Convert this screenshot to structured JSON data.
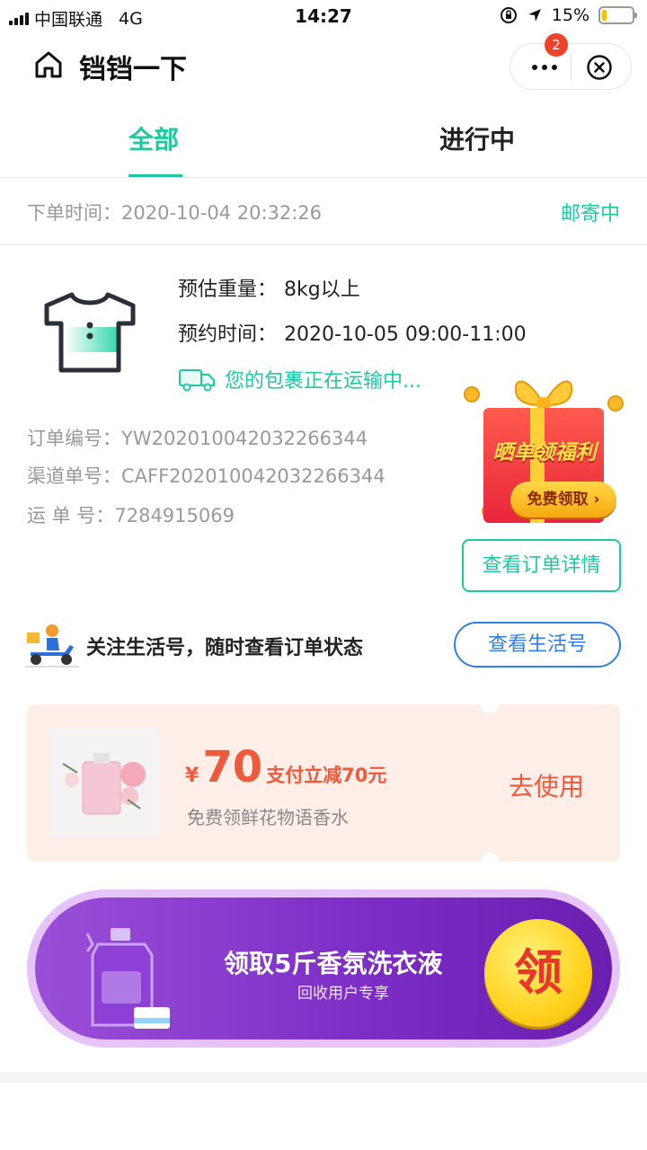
{
  "status_bar": {
    "carrier": "中国联通",
    "network": "4G",
    "time": "14:27",
    "battery": "15%",
    "battery_level": 0.15
  },
  "nav": {
    "title": "铛铛一下",
    "badge_count": "2"
  },
  "tabs": [
    {
      "label": "全部",
      "active": true
    },
    {
      "label": "进行中",
      "active": false
    }
  ],
  "order": {
    "time_label": "下单时间：",
    "time_value": "2020-10-04 20:32:26",
    "status": "邮寄中",
    "weight_label": "预估重量：",
    "weight_value": "8kg以上",
    "appoint_label": "预约时间：",
    "appoint_value": "2020-10-05 09:00-11:00",
    "shipping_text": "您的包裹正在运输中...",
    "order_no_label": "订单编号：",
    "order_no": "YW202010042032266344",
    "channel_no_label": "渠道单号：",
    "channel_no": "CAFF202010042032266344",
    "waybill_label": "运 单 号：",
    "waybill_no": "7284915069",
    "detail_button": "查看订单详情"
  },
  "gift": {
    "title": "晒单领福利",
    "button": "免费领取 ›"
  },
  "follow": {
    "text": "关注生活号，随时查看订单状态",
    "button": "查看生活号"
  },
  "coupon": {
    "currency": "¥",
    "amount": "70",
    "desc": "支付立减70元",
    "subtitle": "免费领鲜花物语香水",
    "use_button": "去使用"
  },
  "banner": {
    "title": "领取5斤香氛洗衣液",
    "subtitle": "回收用户专享",
    "circle_text": "领"
  },
  "colors": {
    "accent": "#1fc9a0",
    "coupon_red": "#f05a3c",
    "link_blue": "#2f7fe8",
    "banner_purple": "#7b2cc4"
  }
}
